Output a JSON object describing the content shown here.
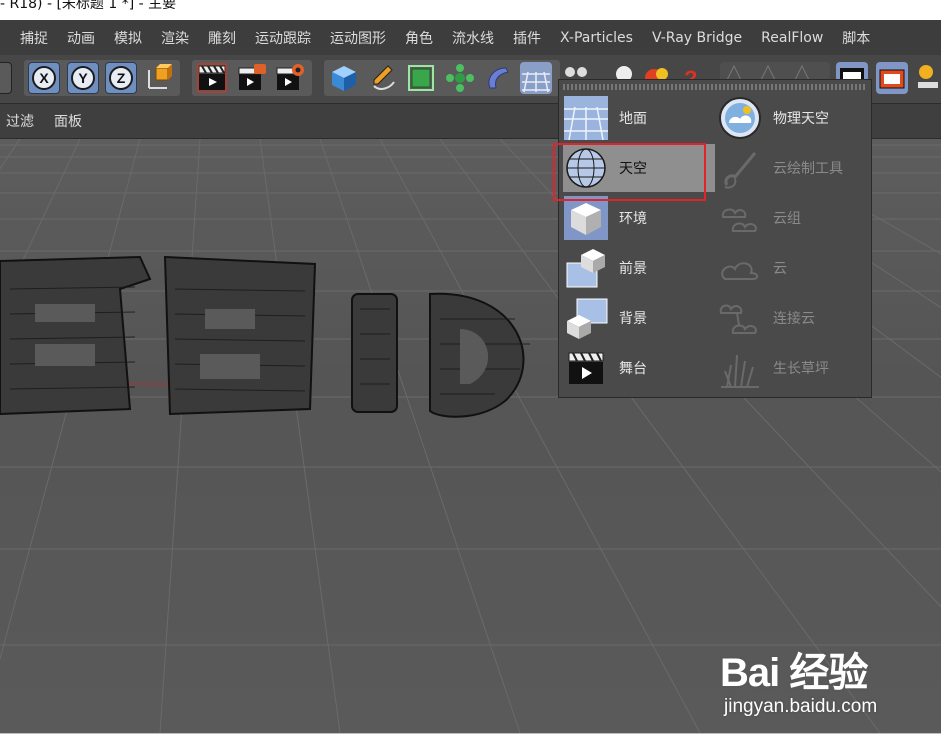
{
  "window": {
    "title": "- R18) - [未标题 1 *] - 主要"
  },
  "menubar": {
    "items": [
      "捕捉",
      "动画",
      "模拟",
      "渲染",
      "雕刻",
      "运动跟踪",
      "运动图形",
      "角色",
      "流水线",
      "插件",
      "X-Particles",
      "V-Ray Bridge",
      "RealFlow",
      "脚本"
    ]
  },
  "toolbar": {
    "axis_buttons": [
      "X",
      "Y",
      "Z"
    ]
  },
  "subbar": {
    "items": [
      "过滤",
      "面板"
    ]
  },
  "dropdown": {
    "left_items": [
      {
        "label": "地面",
        "icon": "floor-icon",
        "state": "normal"
      },
      {
        "label": "天空",
        "icon": "sky-icon",
        "state": "selected"
      },
      {
        "label": "环境",
        "icon": "environment-icon",
        "state": "normal"
      },
      {
        "label": "前景",
        "icon": "foreground-icon",
        "state": "normal"
      },
      {
        "label": "背景",
        "icon": "background-icon",
        "state": "normal"
      },
      {
        "label": "舞台",
        "icon": "stage-icon",
        "state": "normal"
      }
    ],
    "right_items": [
      {
        "label": "物理天空",
        "icon": "physical-sky-icon",
        "state": "normal"
      },
      {
        "label": "云绘制工具",
        "icon": "cloud-paint-tool-icon",
        "state": "disabled"
      },
      {
        "label": "云组",
        "icon": "cloud-group-icon",
        "state": "disabled"
      },
      {
        "label": "云",
        "icon": "cloud-icon",
        "state": "disabled"
      },
      {
        "label": "连接云",
        "icon": "connect-clouds-icon",
        "state": "disabled"
      },
      {
        "label": "生长草坪",
        "icon": "grow-grass-icon",
        "state": "disabled"
      }
    ]
  },
  "viewport": {
    "model_text": "百度ID"
  },
  "watermark": {
    "logo": "Bai 经验",
    "url": "jingyan.baidu.com"
  },
  "colors": {
    "highlight": "#e0242c",
    "axis_blue": "#6f8fbf",
    "ui_dark": "#3d3d3d"
  }
}
